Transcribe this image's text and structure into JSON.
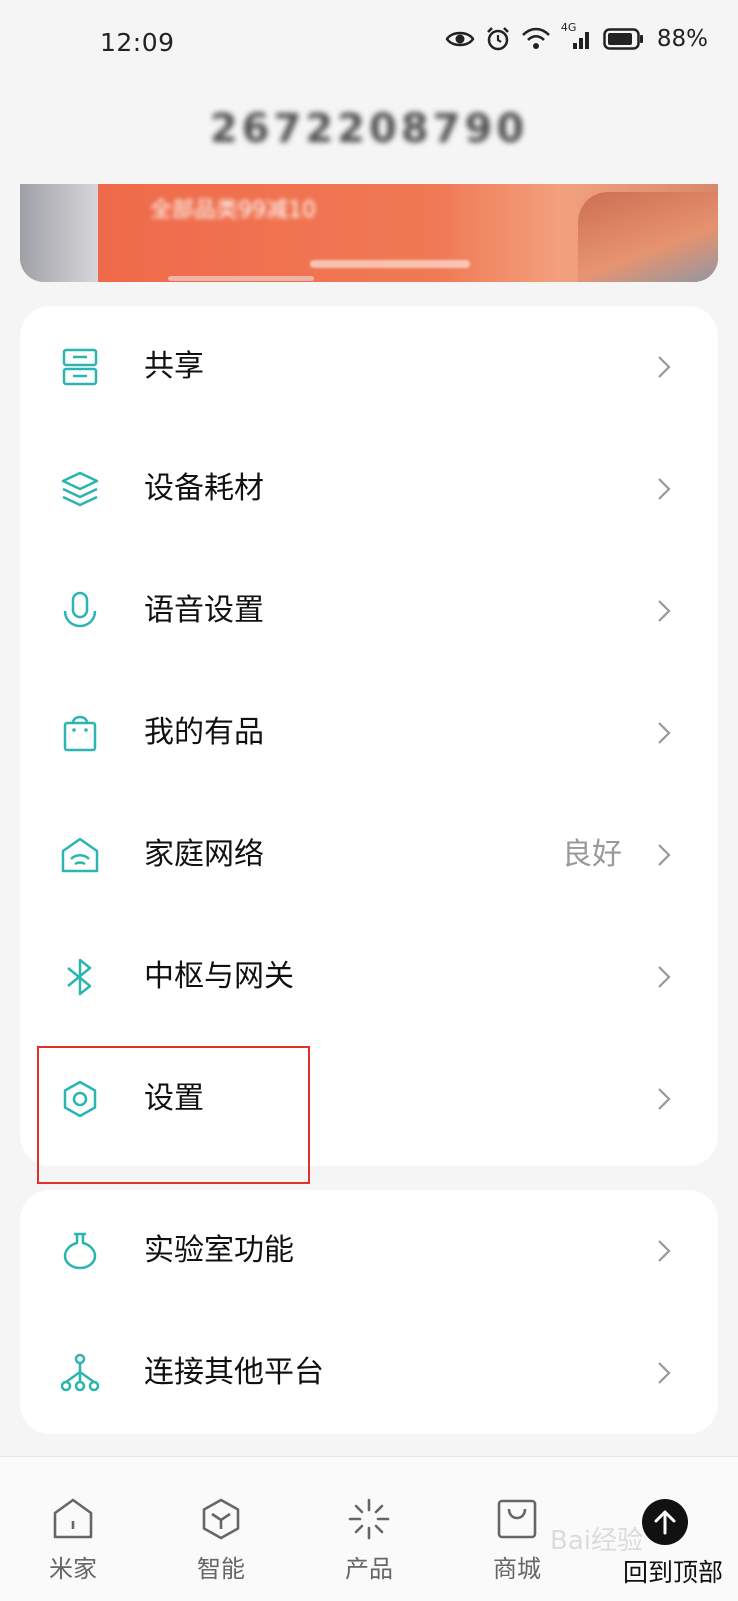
{
  "status_bar": {
    "time": "12:09",
    "battery_percent": "88%",
    "network": "4G",
    "icons": [
      "eye-icon",
      "alarm-icon",
      "wifi-icon",
      "signal-icon",
      "battery-icon"
    ]
  },
  "user": {
    "id": "2672208790"
  },
  "banner": {
    "text": "全部品类99减10"
  },
  "menu_group_1": [
    {
      "label": "共享",
      "icon": "share-icon"
    },
    {
      "label": "设备耗材",
      "icon": "layers-icon"
    },
    {
      "label": "语音设置",
      "icon": "microphone-icon"
    },
    {
      "label": "我的有品",
      "icon": "shopping-bag-icon"
    },
    {
      "label": "家庭网络",
      "icon": "home-wifi-icon",
      "value": "良好"
    },
    {
      "label": "中枢与网关",
      "icon": "bluetooth-icon"
    },
    {
      "label": "设置",
      "icon": "settings-hexagon-icon"
    }
  ],
  "menu_group_2": [
    {
      "label": "实验室功能",
      "icon": "flask-icon"
    },
    {
      "label": "连接其他平台",
      "icon": "network-tree-icon"
    }
  ],
  "bottom_nav": [
    {
      "label": "米家",
      "icon": "home-icon"
    },
    {
      "label": "智能",
      "icon": "smart-cube-icon"
    },
    {
      "label": "产品",
      "icon": "sparkle-icon"
    },
    {
      "label": "商城",
      "icon": "store-bag-icon"
    }
  ],
  "back_to_top": {
    "label": "回到顶部",
    "icon": "arrow-up-icon"
  },
  "watermark": "Bai经验",
  "colors": {
    "accent": "#2bb5b0",
    "highlight": "#e0302a",
    "banner": "#ef6a4a"
  }
}
